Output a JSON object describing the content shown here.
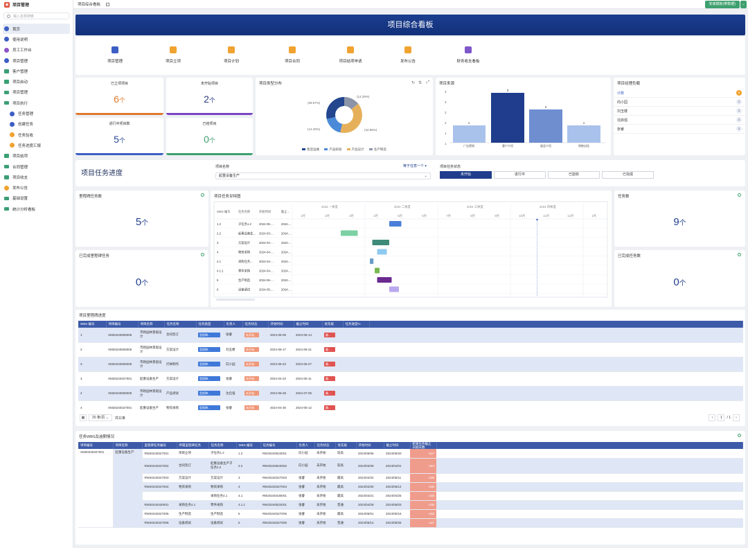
{
  "app": {
    "title": "项目管理",
    "search_placeholder": "输入名称搜索"
  },
  "nav": [
    {
      "label": "首页",
      "icon": "home-icon",
      "type": "main",
      "active": true
    },
    {
      "label": "使用说明",
      "icon": "doc-icon",
      "type": "main"
    },
    {
      "label": "员工工作台",
      "icon": "person-icon",
      "type": "person"
    },
    {
      "label": "项目管理",
      "icon": "project-icon",
      "type": "main"
    },
    {
      "label": "客户管理",
      "icon": "folder-icon",
      "type": "folder"
    },
    {
      "label": "项目启动",
      "icon": "folder-icon",
      "type": "folder"
    },
    {
      "label": "项目管理",
      "icon": "folder-icon",
      "type": "folder"
    },
    {
      "label": "项目执行",
      "icon": "folder-icon",
      "type": "folder"
    },
    {
      "label": "任务管理",
      "icon": "task-icon",
      "type": "sub"
    },
    {
      "label": "创建任务",
      "icon": "task-icon",
      "type": "sub"
    },
    {
      "label": "任务验收",
      "icon": "check-icon",
      "type": "sub-orange"
    },
    {
      "label": "任务进度汇报",
      "icon": "report-icon",
      "type": "sub-orange"
    },
    {
      "label": "项目结项",
      "icon": "folder-icon",
      "type": "folder"
    },
    {
      "label": "合同管理",
      "icon": "folder-icon",
      "type": "folder"
    },
    {
      "label": "项目收支",
      "icon": "folder-icon",
      "type": "folder"
    },
    {
      "label": "发布公告",
      "icon": "announce-icon",
      "type": "orange"
    },
    {
      "label": "基础设置",
      "icon": "folder-icon",
      "type": "folder"
    },
    {
      "label": "统计分析看板",
      "icon": "folder-icon",
      "type": "folder"
    }
  ],
  "topbar": {
    "tab": "项目综合看板",
    "button": "安装模板(带数据)"
  },
  "banner": {
    "title": "项目综合看板"
  },
  "quick": [
    {
      "label": "项目管理",
      "color": "#3d5ec4"
    },
    {
      "label": "项目立项",
      "color": "#f0a330"
    },
    {
      "label": "项目计划",
      "color": "#f0a330"
    },
    {
      "label": "项目合同",
      "color": "#f0a330"
    },
    {
      "label": "项目结项申请",
      "color": "#f0a330"
    },
    {
      "label": "发布公告",
      "color": "#f0a330"
    },
    {
      "label": "财务收支看板",
      "color": "#7e57c9"
    }
  ],
  "stats": {
    "started": {
      "label": "已立项项目",
      "value": "6",
      "unit": "个",
      "color": "#e0782c"
    },
    "pending": {
      "label": "未开始项目",
      "value": "2",
      "unit": "个",
      "color": "#2b3c7e"
    },
    "inprogress": {
      "label": "进行中项目数",
      "value": "5",
      "unit": "个",
      "color": "#2b4a9a"
    },
    "done": {
      "label": "已结项目",
      "value": "0",
      "unit": "个",
      "color": "#3ea06e"
    }
  },
  "pie": {
    "title": "项目类型分布",
    "labels": {
      "tr": "(14.29%)",
      "tl": "(28.57%)",
      "bl": "(14.29%)",
      "br": "(42.86%)"
    }
  },
  "bar": {
    "title": "项目来源"
  },
  "pm": {
    "title": "项目经理负载",
    "rows": [
      {
        "name": "计数",
        "count": "2"
      },
      {
        "name": "向小园",
        "count": "1"
      },
      {
        "name": "刘玉楼",
        "count": "1"
      },
      {
        "name": "沈启强",
        "count": "1"
      },
      {
        "name": "张睿",
        "count": "1"
      }
    ]
  },
  "progress": {
    "title": "项目任务进度",
    "name_label": "项目名称",
    "name_value": "起重设备生产",
    "equals": "等于任意一个 ▾",
    "status_label": "项目任务状态",
    "statuses": [
      "未开始",
      "进行中",
      "已验收",
      "已完成"
    ]
  },
  "ms": {
    "title": "里程碑任务数",
    "value": "5",
    "unit": "个",
    "done_title": "已完成里程碑任务",
    "done_value": "0"
  },
  "tasks": {
    "title": "任务数",
    "value": "9",
    "unit": "个",
    "done_title": "已完成任务数",
    "done_value": "0"
  },
  "gantt": {
    "title": "项目任务甘特图",
    "headers": [
      "WBS 编号",
      "任务名称",
      "开始时间",
      "截止..."
    ],
    "quarters": [
      "2024 一季度",
      "2024 二季度",
      "2024 三季度",
      "2024 四季度",
      "2025 一季度"
    ],
    "months": [
      "1月",
      "2月",
      "3月",
      "4月",
      "5月",
      "6月",
      "7月",
      "8月",
      "9月",
      "10月",
      "11月",
      "12月",
      "1月",
      "2月"
    ],
    "rows": [
      {
        "wbs": "1.2",
        "name": "子任务1.2",
        "start": "2024-05-..."
      },
      {
        "wbs": "2.2",
        "name": "起重设备生...",
        "start": "2024-03-..."
      },
      {
        "wbs": "3",
        "name": "方案设计",
        "start": "2024-04-..."
      },
      {
        "wbs": "4",
        "name": "物资采购",
        "start": "2024-04-..."
      },
      {
        "wbs": "4.1",
        "name": "采购任务...",
        "start": "2024-04-..."
      },
      {
        "wbs": "4.1.1",
        "name": "零件采购",
        "start": "2024-04-..."
      },
      {
        "wbs": "5",
        "name": "生产制造",
        "start": "2024-05-..."
      },
      {
        "wbs": "6",
        "name": "设备调试",
        "start": "2024-05-..."
      }
    ]
  },
  "mstable": {
    "title": "项目里程碑进度",
    "headers": [
      "WBS 编号",
      "项目编号",
      "项目名称",
      "任务名称",
      "任务类型",
      "负责人",
      "任务状态",
      "开始时间",
      "截止时间",
      "优先级",
      "任务进度%"
    ],
    "rows": [
      {
        "wbs": "1",
        "code": "XM20240605005",
        "pname": "市政园林景观设计",
        "task": "合同签订",
        "type": "里程碑...",
        "owner": "张睿",
        "status": "未开始",
        "start": "2024-06-05",
        "end": "2024-06-14",
        "pri": "最..."
      },
      {
        "wbs": "2",
        "code": "XM20240605005",
        "pname": "市政园林景观设计",
        "task": "方案设计",
        "type": "里程碑...",
        "owner": "刘玉楼",
        "status": "未开始",
        "start": "2024-06-17",
        "end": "2024-06-21",
        "pri": "最..."
      },
      {
        "wbs": "3",
        "code": "XM20240605005",
        "pname": "市政园林景观设计",
        "task": "打样制作",
        "type": "里程碑...",
        "owner": "向小园",
        "status": "未开始",
        "start": "2024-06-22",
        "end": "2024-06-27",
        "pri": "最..."
      },
      {
        "wbs": "3",
        "code": "XM20240327001",
        "pname": "起重设备生产",
        "task": "方案设计",
        "type": "里程碑...",
        "owner": "张睿",
        "status": "未开始",
        "start": "2024-04-22",
        "end": "2024-05-11",
        "pri": "最..."
      },
      {
        "wbs": "4",
        "code": "XM20240605005",
        "pname": "市政园林景观设计",
        "task": "产品调试",
        "type": "里程碑...",
        "owner": "沈启强",
        "status": "未开始",
        "start": "2024-06-28",
        "end": "2024-07-05",
        "pri": "最..."
      },
      {
        "wbs": "4",
        "code": "XM20240327001",
        "pname": "起重设备生产",
        "task": "物资采购",
        "type": "里程碑...",
        "owner": "张睿",
        "status": "未开始",
        "start": "2024-04-30",
        "end": "2024-05-12",
        "pri": "最..."
      }
    ],
    "pager": {
      "size": "20 条/页",
      "total": "共11条",
      "page": "1",
      "pages": "/ 1"
    }
  },
  "wbs": {
    "title": "任务WBS及逾期情况",
    "headers": [
      "项目编号",
      "项目名称",
      "里程碑任务编号",
      "所属里程碑任务",
      "任务名称",
      "WBS 编号",
      "任务编号",
      "负责人",
      "任务状态",
      "优先级",
      "开始时间",
      "截止时间",
      "距离任务截止日期天数"
    ],
    "proj_code": "XM20240327001",
    "proj_name": "起重设备生产",
    "rows": [
      {
        "mcode": "RW20240327001",
        "mtask": "项目立项",
        "tname": "子任务1.2",
        "wbs": "1.2",
        "tcode": "RW20240523001",
        "owner": "向小园",
        "status": "未开始",
        "pri": "较高",
        "start": "2024/05/06",
        "end": "2024/05/20",
        "days": "-127"
      },
      {
        "mcode": "RW20240327002",
        "mtask": "合同签订",
        "tname": "起重设备生产子任务2.2",
        "wbs": "2.2",
        "tcode": "RW20240523002",
        "owner": "向小园",
        "status": "未开始",
        "pri": "较高",
        "start": "2024/03/30",
        "end": "2024/04/01",
        "days": "-164"
      },
      {
        "mcode": "RW20240327003",
        "mtask": "方案设计",
        "tname": "方案设计",
        "wbs": "3",
        "tcode": "RW20240327003",
        "owner": "张睿",
        "status": "未开始",
        "pri": "最高",
        "start": "2024/04/22",
        "end": "2024/05/11",
        "days": "-136"
      },
      {
        "mcode": "RW20240327004",
        "mtask": "物资采购",
        "tname": "物资采购",
        "wbs": "4",
        "tcode": "RW20240327004",
        "owner": "张睿",
        "status": "未开始",
        "pri": "最高",
        "start": "2024/04/30",
        "end": "2024/05/12",
        "days": "-135"
      },
      {
        "mcode": "",
        "mtask": "",
        "tname": "采购任务4.1",
        "wbs": "4.1",
        "tcode": "RW20240430001",
        "owner": "张睿",
        "status": "未开始",
        "pri": "最高",
        "start": "2024/04/21",
        "end": "2024/04/25",
        "days": "-146"
      },
      {
        "mcode": "RW20240430001",
        "mtask": "采购任务4.1",
        "tname": "零件采购",
        "wbs": "4.1.1",
        "tcode": "RW20240522001",
        "owner": "张睿",
        "status": "未开始",
        "pri": "普通",
        "start": "2024/04/28",
        "end": "2024/05/03",
        "days": "-135"
      },
      {
        "mcode": "RW20240327005",
        "mtask": "生产制造",
        "tname": "生产制造",
        "wbs": "5",
        "tcode": "RW20240327005",
        "owner": "张睿",
        "status": "未开始",
        "pri": "最高",
        "start": "2024/05/01",
        "end": "2024/05/16",
        "days": "-132"
      },
      {
        "mcode": "RW20240327006",
        "mtask": "设备调试",
        "tname": "设备调试",
        "wbs": "6",
        "tcode": "RW20240327006",
        "owner": "张睿",
        "status": "未开始",
        "pri": "普通",
        "start": "2024/05/14",
        "end": "2024/05/26",
        "days": "-117"
      }
    ]
  }
}
